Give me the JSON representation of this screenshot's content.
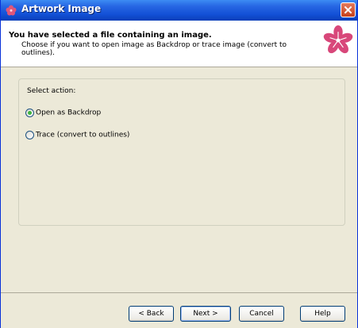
{
  "window": {
    "title": "Artwork Image"
  },
  "header": {
    "title": "You have selected a file containing an image.",
    "description": "Choose if you want to open image as Backdrop or trace image (convert to outlines)."
  },
  "group": {
    "label": "Select action:",
    "options": [
      {
        "label": "Open as Backdrop",
        "selected": true
      },
      {
        "label": "Trace (convert to outlines)",
        "selected": false
      }
    ]
  },
  "buttons": {
    "back": "< Back",
    "next": "Next >",
    "cancel": "Cancel",
    "help": "Help"
  },
  "colors": {
    "titlebar": "#2767e3",
    "dialog_bg": "#ece9d8",
    "logo": "#d8477a",
    "radio_selected": "#3fb43f"
  }
}
